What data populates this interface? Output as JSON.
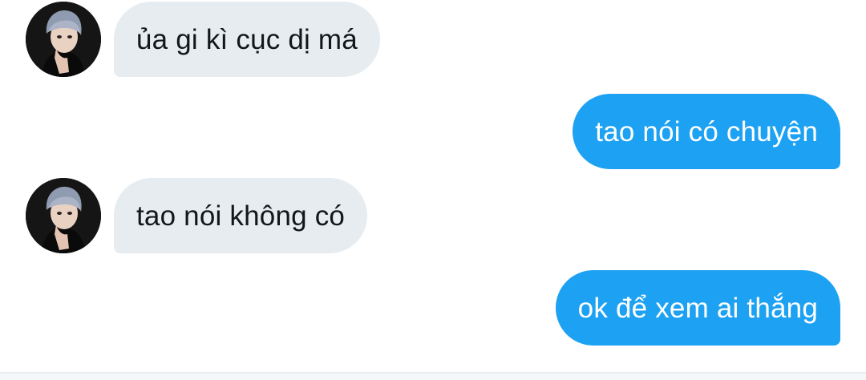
{
  "conversation": {
    "messages": [
      {
        "direction": "received",
        "text": "ủa gi kì cục dị má",
        "avatar": "profile-avatar"
      },
      {
        "direction": "sent",
        "text": "tao nói có chuyện"
      },
      {
        "direction": "received",
        "text": "tao nói không có",
        "avatar": "profile-avatar"
      },
      {
        "direction": "sent",
        "text": "ok để xem ai thắng"
      }
    ]
  },
  "colors": {
    "received_bubble": "#e6ecf0",
    "sent_bubble": "#1da1f2",
    "received_text": "#14171a",
    "sent_text": "#ffffff"
  }
}
